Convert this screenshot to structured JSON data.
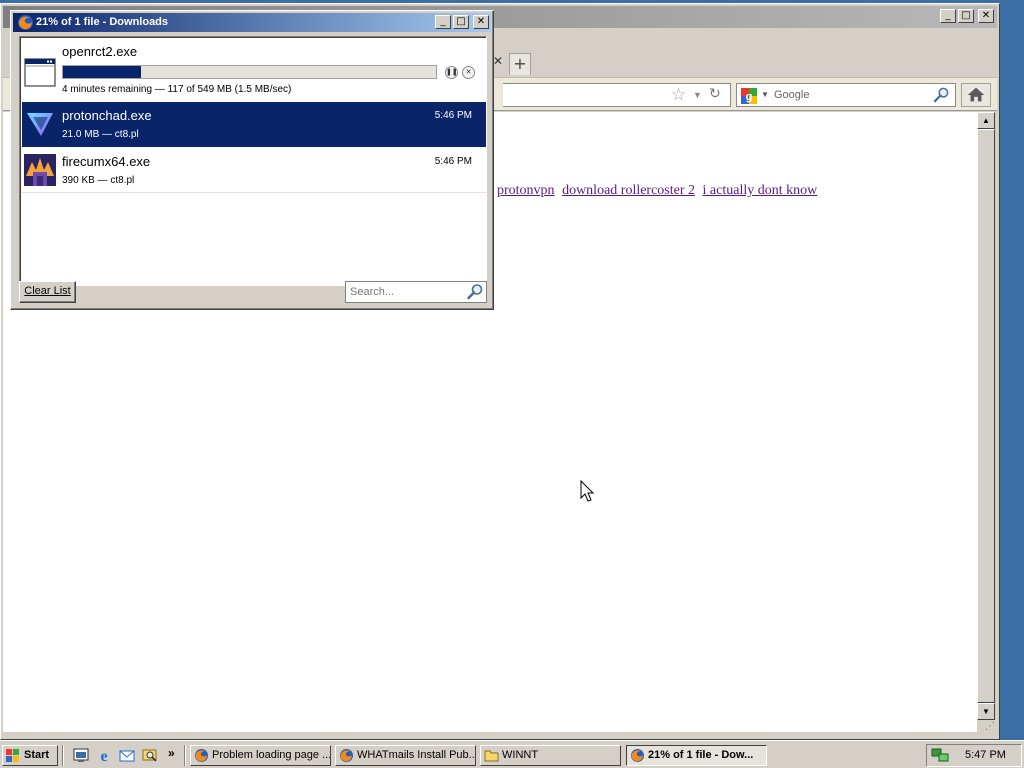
{
  "browser": {
    "search_engine": "Google",
    "page_links": [
      "protonvpn",
      "download rollercoster 2",
      "i actually dont know"
    ]
  },
  "downloads": {
    "window_title": "21% of 1 file - Downloads",
    "items": [
      {
        "name": "openrct2.exe",
        "status": "4 minutes remaining — 117 of 549 MB (1.5 MB/sec)",
        "progress": 0.21,
        "state": "downloading"
      },
      {
        "name": "protonchad.exe",
        "status": "21.0 MB — ct8.pl",
        "time": "5:46 PM",
        "state": "selected"
      },
      {
        "name": "firecumx64.exe",
        "status": "390 KB — ct8.pl",
        "time": "5:46 PM",
        "state": "done"
      }
    ],
    "clear_list_label": "Clear List",
    "search_placeholder": "Search..."
  },
  "taskbar": {
    "start_label": "Start",
    "quick_more": "»",
    "tasks": [
      {
        "label": "Problem loading page ..."
      },
      {
        "label": "WHATmails Install Pub..."
      },
      {
        "label": "WINNT"
      },
      {
        "label": "21% of 1 file - Dow..."
      }
    ],
    "clock": "5:47 PM"
  },
  "colors": {
    "selection": "#0a246a",
    "link_visited": "#551a8b",
    "title_active_start": "#0a246a",
    "title_active_end": "#a6caf0",
    "desktop": "#3a6ea5"
  }
}
